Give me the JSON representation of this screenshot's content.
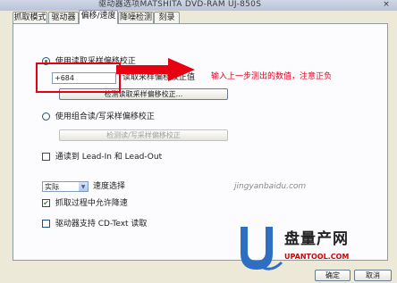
{
  "window": {
    "title": "驱动器选项MATSHITA DVD-RAM UJ-850S",
    "close_glyph": "×"
  },
  "tabs": [
    {
      "label": "抓取模式"
    },
    {
      "label": "驱动器"
    },
    {
      "label": "偏移/速度"
    },
    {
      "label": "降噪检测"
    },
    {
      "label": "刻录"
    }
  ],
  "offset": {
    "option_read_label": "使用读取采样偏移校正",
    "read_offset_label": "读取采样偏移校正值",
    "read_offset_value": "+684",
    "detect_read_button": "检测读取采样偏移校正...",
    "option_combined_label": "使用组合读/写采样偏移校正",
    "detect_combined_button": "检测读/写采样偏移校正"
  },
  "options": {
    "overread_label": "通读到 Lead-In 和 Lead-Out",
    "speed_value": "实际",
    "speed_label": "速度选择",
    "allow_speed_reduction_label": "抓取过程中允许降速",
    "cdtext_label": "驱动器支持 CD-Text 读取"
  },
  "annotation": {
    "text": "输入上一步测出的数值，注意正负",
    "color": "#e8001c"
  },
  "watermark": {
    "logo_text": "盘量产网",
    "url_text": "UPANTOOL.COM",
    "site_text": "jingyanbaidu.com"
  },
  "footer": {
    "ok_label": "确定",
    "cancel_label": "取消"
  }
}
